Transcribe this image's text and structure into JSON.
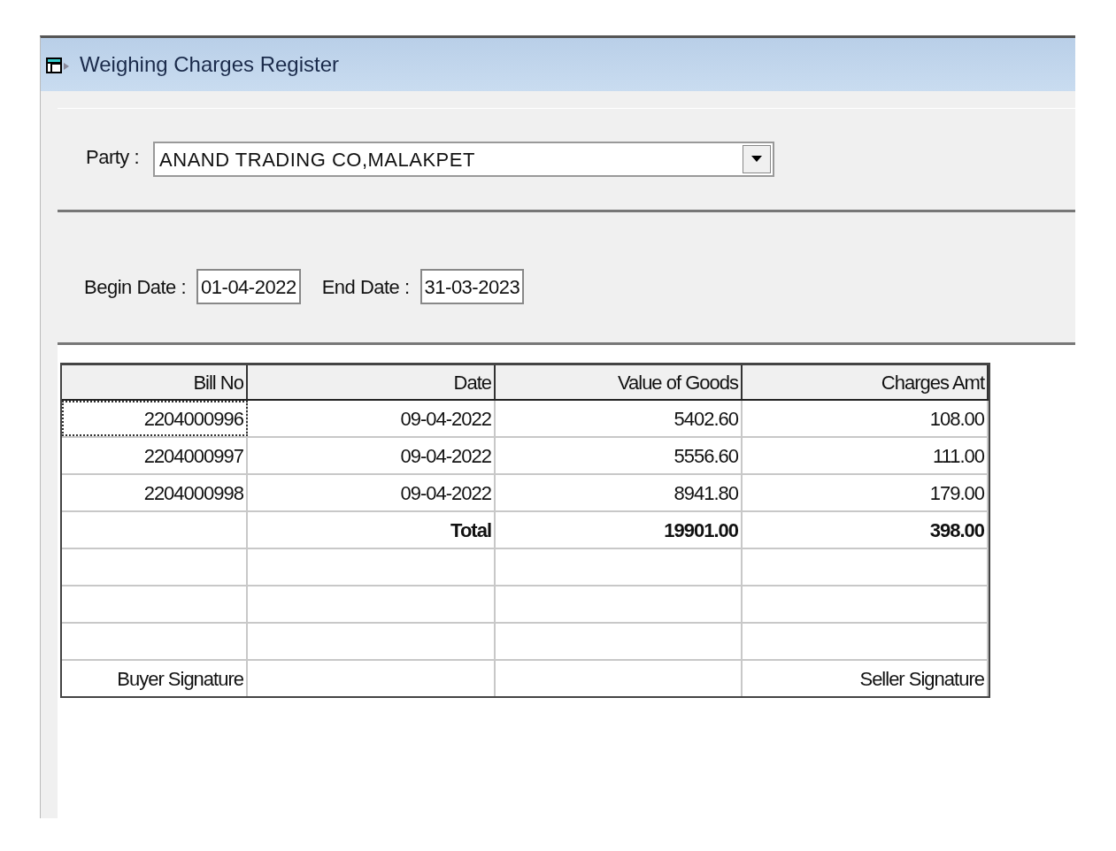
{
  "window": {
    "title": "Weighing Charges Register"
  },
  "party": {
    "label": "Party :",
    "value": "ANAND TRADING CO,MALAKPET"
  },
  "dates": {
    "begin_label": "Begin Date :",
    "begin_value": "01-04-2022",
    "end_label": "End Date :",
    "end_value": "31-03-2023"
  },
  "table": {
    "columns": [
      "Bill No",
      "Date",
      "Value of Goods",
      "Charges Amt"
    ],
    "rows": [
      {
        "kind": "data",
        "cells": [
          "2204000996",
          "09-04-2022",
          "5402.60",
          "108.00"
        ],
        "focused": true
      },
      {
        "kind": "data",
        "cells": [
          "2204000997",
          "09-04-2022",
          "5556.60",
          "111.00"
        ],
        "focused": false
      },
      {
        "kind": "data",
        "cells": [
          "2204000998",
          "09-04-2022",
          "8941.80",
          "179.00"
        ],
        "focused": false
      },
      {
        "kind": "total",
        "cells": [
          "",
          "Total",
          "19901.00",
          "398.00"
        ],
        "focused": false
      },
      {
        "kind": "blank",
        "cells": [
          "",
          "",
          "",
          ""
        ],
        "focused": false
      },
      {
        "kind": "blank",
        "cells": [
          "",
          "",
          "",
          ""
        ],
        "focused": false
      },
      {
        "kind": "blank",
        "cells": [
          "",
          "",
          "",
          ""
        ],
        "focused": false
      },
      {
        "kind": "signature",
        "cells": [
          "Buyer Signature",
          "",
          "",
          "Seller Signature"
        ],
        "focused": false
      }
    ]
  }
}
